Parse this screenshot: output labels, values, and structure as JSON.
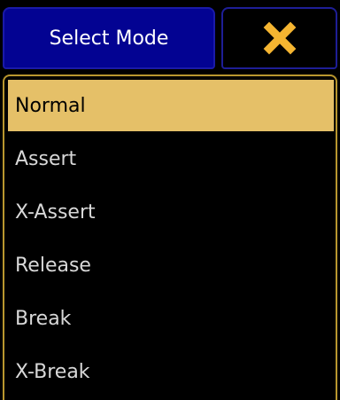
{
  "header": {
    "title": "Select Mode"
  },
  "close_button": {
    "icon": "close-icon",
    "color": "#f5b531"
  },
  "modes": [
    {
      "label": "Normal",
      "selected": true
    },
    {
      "label": "Assert",
      "selected": false
    },
    {
      "label": "X-Assert",
      "selected": false
    },
    {
      "label": "Release",
      "selected": false
    },
    {
      "label": "Break",
      "selected": false
    },
    {
      "label": "X-Break",
      "selected": false
    }
  ],
  "colors": {
    "header_bg": "#030392",
    "selected_bg": "#e5c068",
    "panel_border": "#b8962e"
  }
}
